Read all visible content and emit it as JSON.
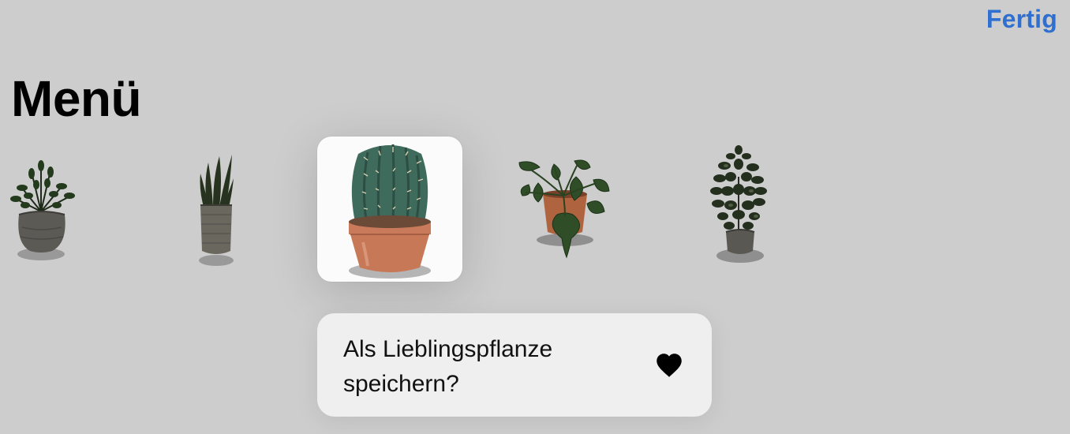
{
  "nav": {
    "done_label": "Fertig"
  },
  "page": {
    "title": "Menü"
  },
  "plants": [
    {
      "name": "zz-plant",
      "icon": "zz-plant-in-grey-bowl"
    },
    {
      "name": "snake-plant",
      "icon": "snake-plant-in-grey-pot"
    },
    {
      "name": "cactus",
      "icon": "cactus-in-terracotta-pot",
      "selected": true
    },
    {
      "name": "philodendron",
      "icon": "philodendron-in-terracotta-pot"
    },
    {
      "name": "ficus",
      "icon": "small-tree-in-grey-pot"
    }
  ],
  "context_menu": {
    "label": "Als Lieblingspflanze speichern?",
    "icon": "heart-icon"
  },
  "colors": {
    "accent": "#2f6fd0",
    "background": "#cdcdcd",
    "menu_background": "#efefef"
  }
}
